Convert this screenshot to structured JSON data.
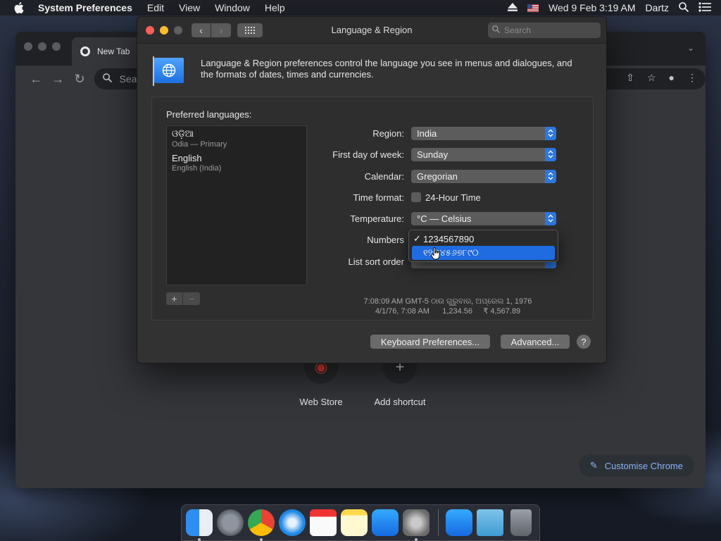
{
  "menubar": {
    "app_name": "System Preferences",
    "items": [
      "Edit",
      "View",
      "Window",
      "Help"
    ],
    "clock": "Wed 9 Feb  3:19 AM",
    "user": "Dartz"
  },
  "chrome": {
    "tab_title": "New Tab",
    "omnibox_placeholder": "Sear",
    "shortcuts": [
      "Web Store",
      "Add shortcut"
    ],
    "customise_label": "Customise Chrome"
  },
  "prefs": {
    "window_title": "Language & Region",
    "search_placeholder": "Search",
    "description": "Language & Region preferences control the language you see in menus and dialogues, and the formats of dates, times and currencies.",
    "preferred_languages_label": "Preferred languages:",
    "languages": [
      {
        "name": "ଓଡ଼ିଆ",
        "sub": "Odia — Primary"
      },
      {
        "name": "English",
        "sub": "English (India)"
      }
    ],
    "fields": {
      "region_label": "Region:",
      "region_value": "India",
      "first_day_label": "First day of week:",
      "first_day_value": "Sunday",
      "calendar_label": "Calendar:",
      "calendar_value": "Gregorian",
      "time_format_label": "Time format:",
      "time_format_checkbox": "24-Hour Time",
      "temperature_label": "Temperature:",
      "temperature_value": "°C — Celsius",
      "numbers_label": "Numbers",
      "list_sort_label": "List sort order"
    },
    "sample_line1": "7:08:09 AM GMT-5 ଠାଉ ଗୁରୁବାର, ଅପ୍ରେଲ 1, 1976",
    "sample_line2": "4/1/76, 7:08 AM      1,234.56     ₹ 4,567.89",
    "keyboard_button": "Keyboard Preferences...",
    "advanced_button": "Advanced...",
    "help_button": "?",
    "numbers_menu": {
      "options": [
        "1234567890",
        "୧୨୩୪୫୬୭୮୯୦"
      ],
      "checked_index": 0,
      "highlighted_index": 1
    }
  },
  "colors": {
    "accent": "#2c77e0",
    "close": "#fe5f57",
    "minimize": "#febc2e"
  }
}
